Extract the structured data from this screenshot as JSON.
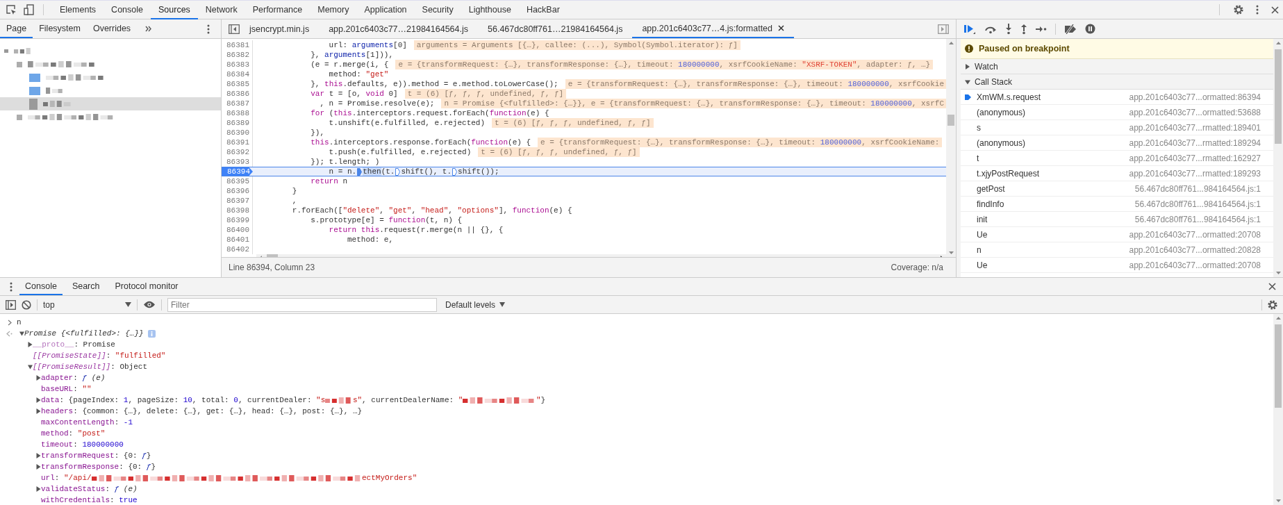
{
  "main_tabs": [
    {
      "label": "Elements",
      "selected": false
    },
    {
      "label": "Console",
      "selected": false
    },
    {
      "label": "Sources",
      "selected": true
    },
    {
      "label": "Network",
      "selected": false
    },
    {
      "label": "Performance",
      "selected": false
    },
    {
      "label": "Memory",
      "selected": false
    },
    {
      "label": "Application",
      "selected": false
    },
    {
      "label": "Security",
      "selected": false
    },
    {
      "label": "Lighthouse",
      "selected": false
    },
    {
      "label": "HackBar",
      "selected": false
    }
  ],
  "navigator": {
    "tabs": [
      {
        "label": "Page",
        "selected": true
      },
      {
        "label": "Filesystem",
        "selected": false
      },
      {
        "label": "Overrides",
        "selected": false
      }
    ],
    "tree": [
      {
        "kind": "frame",
        "selected": false,
        "children": [
          {
            "kind": "domain",
            "selected": false,
            "children": [
              {
                "kind": "folder",
                "selected": false
              },
              {
                "kind": "folder",
                "selected": false
              },
              {
                "kind": "file",
                "selected": true
              }
            ]
          },
          {
            "kind": "domain",
            "selected": false
          }
        ]
      }
    ]
  },
  "editor": {
    "tabs": [
      {
        "label": "jsencrypt.min.js",
        "selected": false,
        "closable": false
      },
      {
        "label": "app.201c6403c77…21984164564.js",
        "selected": false,
        "closable": false
      },
      {
        "label": "56.467dc80ff761…21984164564.js",
        "selected": false,
        "closable": false
      },
      {
        "label": "app.201c6403c77…4.js:formatted",
        "selected": true,
        "closable": true
      }
    ],
    "lines": [
      {
        "number": "86381",
        "current": false,
        "tokens": [
          {
            "kind": "plain",
            "text": "                url: "
          },
          {
            "kind": "var",
            "text": "arguments"
          },
          {
            "kind": "plain",
            "text": "[0]"
          }
        ],
        "inline": [
          {
            "kind": "plain",
            "text": "arguments = Arguments [{…}, callee: (...), Symbol(Symbol.iterator): ƒ]"
          }
        ]
      },
      {
        "number": "86382",
        "current": false,
        "tokens": [
          {
            "kind": "plain",
            "text": "            }, "
          },
          {
            "kind": "var",
            "text": "arguments"
          },
          {
            "kind": "plain",
            "text": "[1])),"
          }
        ]
      },
      {
        "number": "86383",
        "current": false,
        "tokens": [
          {
            "kind": "plain",
            "text": "            (e = r.merge(i, {"
          }
        ],
        "inline": [
          {
            "kind": "plain",
            "text": "e = {transformRequest: {…}, transformResponse: {…}, timeout: "
          },
          {
            "kind": "num",
            "text": "180000000"
          },
          {
            "kind": "plain",
            "text": ", xsrfCookieName: "
          },
          {
            "kind": "str",
            "text": "\"XSRF-TOKEN\""
          },
          {
            "kind": "plain",
            "text": ", adapter: ƒ, …}"
          }
        ]
      },
      {
        "number": "86384",
        "current": false,
        "tokens": [
          {
            "kind": "plain",
            "text": "                method: "
          },
          {
            "kind": "str",
            "text": "\"get\""
          }
        ]
      },
      {
        "number": "86385",
        "current": false,
        "tokens": [
          {
            "kind": "plain",
            "text": "            }, "
          },
          {
            "kind": "kw",
            "text": "this"
          },
          {
            "kind": "plain",
            "text": ".defaults, e)).method = e.method.toLowerCase();"
          }
        ],
        "inline": [
          {
            "kind": "plain",
            "text": "e = {transformRequest: {…}, transformResponse: {…}, timeout: "
          },
          {
            "kind": "num",
            "text": "180000000"
          },
          {
            "kind": "plain",
            "text": ", xsrfCookie"
          }
        ]
      },
      {
        "number": "86386",
        "current": false,
        "tokens": [
          {
            "kind": "kw",
            "text": "            var"
          },
          {
            "kind": "plain",
            "text": " t = [o, "
          },
          {
            "kind": "kw",
            "text": "void"
          },
          {
            "kind": "plain",
            "text": " 0]"
          }
        ],
        "inline": [
          {
            "kind": "plain",
            "text": "t = (6) [ƒ, ƒ, ƒ, undefined, ƒ, ƒ]"
          }
        ]
      },
      {
        "number": "86387",
        "current": false,
        "tokens": [
          {
            "kind": "plain",
            "text": "              , n = Promise.resolve(e);"
          }
        ],
        "inline": [
          {
            "kind": "plain",
            "text": "n = Promise {<fulfilled>: {…}}, e = {transformRequest: {…}, transformResponse: {…}, timeout: "
          },
          {
            "kind": "num",
            "text": "180000000"
          },
          {
            "kind": "plain",
            "text": ", xsrfC"
          }
        ]
      },
      {
        "number": "86388",
        "current": false,
        "tokens": [
          {
            "kind": "kw",
            "text": "            for"
          },
          {
            "kind": "plain",
            "text": " ("
          },
          {
            "kind": "kw",
            "text": "this"
          },
          {
            "kind": "plain",
            "text": ".interceptors.request.forEach("
          },
          {
            "kind": "kw",
            "text": "function"
          },
          {
            "kind": "plain",
            "text": "(e) {"
          }
        ]
      },
      {
        "number": "86389",
        "current": false,
        "tokens": [
          {
            "kind": "plain",
            "text": "                t.unshift(e.fulfilled, e.rejected)"
          }
        ],
        "inline": [
          {
            "kind": "plain",
            "text": "t = (6) [ƒ, ƒ, ƒ, undefined, ƒ, ƒ]"
          }
        ]
      },
      {
        "number": "86390",
        "current": false,
        "tokens": [
          {
            "kind": "plain",
            "text": "            }),"
          }
        ]
      },
      {
        "number": "86391",
        "current": false,
        "tokens": [
          {
            "kind": "kw",
            "text": "            this"
          },
          {
            "kind": "plain",
            "text": ".interceptors.response.forEach("
          },
          {
            "kind": "kw",
            "text": "function"
          },
          {
            "kind": "plain",
            "text": "(e) {"
          }
        ],
        "inline": [
          {
            "kind": "plain",
            "text": "e = {transformRequest: {…}, transformResponse: {…}, timeout: "
          },
          {
            "kind": "num",
            "text": "180000000"
          },
          {
            "kind": "plain",
            "text": ", xsrfCookieName:"
          }
        ]
      },
      {
        "number": "86392",
        "current": false,
        "tokens": [
          {
            "kind": "plain",
            "text": "                t.push(e.fulfilled, e.rejected)"
          }
        ],
        "inline": [
          {
            "kind": "plain",
            "text": "t = (6) [ƒ, ƒ, ƒ, undefined, ƒ, ƒ]"
          }
        ]
      },
      {
        "number": "86393",
        "current": false,
        "tokens": [
          {
            "kind": "plain",
            "text": "            }); t.length; )"
          }
        ]
      },
      {
        "number": "86394",
        "current": true,
        "tokens": [
          {
            "kind": "plain",
            "text": "                n = n."
          },
          {
            "kind": "marker",
            "active": true
          },
          {
            "kind": "exec",
            "text": "then"
          },
          {
            "kind": "plain",
            "text": "(t."
          },
          {
            "kind": "marker",
            "active": false
          },
          {
            "kind": "plain",
            "text": "shift(), t."
          },
          {
            "kind": "marker",
            "active": false
          },
          {
            "kind": "plain",
            "text": "shift());"
          }
        ]
      },
      {
        "number": "86395",
        "current": false,
        "tokens": [
          {
            "kind": "kw",
            "text": "            return"
          },
          {
            "kind": "plain",
            "text": " n"
          }
        ]
      },
      {
        "number": "86396",
        "current": false,
        "tokens": [
          {
            "kind": "plain",
            "text": "        }"
          }
        ]
      },
      {
        "number": "86397",
        "current": false,
        "tokens": [
          {
            "kind": "plain",
            "text": "        ,"
          }
        ]
      },
      {
        "number": "86398",
        "current": false,
        "tokens": [
          {
            "kind": "plain",
            "text": "        r.forEach(["
          },
          {
            "kind": "str",
            "text": "\"delete\""
          },
          {
            "kind": "plain",
            "text": ", "
          },
          {
            "kind": "str",
            "text": "\"get\""
          },
          {
            "kind": "plain",
            "text": ", "
          },
          {
            "kind": "str",
            "text": "\"head\""
          },
          {
            "kind": "plain",
            "text": ", "
          },
          {
            "kind": "str",
            "text": "\"options\""
          },
          {
            "kind": "plain",
            "text": "], "
          },
          {
            "kind": "kw",
            "text": "function"
          },
          {
            "kind": "plain",
            "text": "(e) {"
          }
        ]
      },
      {
        "number": "86399",
        "current": false,
        "tokens": [
          {
            "kind": "plain",
            "text": "            s.prototype[e] = "
          },
          {
            "kind": "kw",
            "text": "function"
          },
          {
            "kind": "plain",
            "text": "(t, n) {"
          }
        ]
      },
      {
        "number": "86400",
        "current": false,
        "tokens": [
          {
            "kind": "kw",
            "text": "                return this"
          },
          {
            "kind": "plain",
            "text": ".request(r.merge(n || {}, {"
          }
        ]
      },
      {
        "number": "86401",
        "current": false,
        "tokens": [
          {
            "kind": "plain",
            "text": "                    method: e,"
          }
        ]
      },
      {
        "number": "86402",
        "current": false
      }
    ],
    "status": {
      "position": "Line 86394, Column 23",
      "coverage": "Coverage: n/a"
    }
  },
  "debugger": {
    "banner": "Paused on breakpoint",
    "sections": [
      {
        "title": "Watch",
        "expanded": false
      },
      {
        "title": "Call Stack",
        "expanded": true
      }
    ],
    "call_stack": [
      {
        "name": "XmWM.s.request",
        "location": "app.201c6403c77...ormatted:86394",
        "current": true
      },
      {
        "name": "(anonymous)",
        "location": "app.201c6403c77...ormatted:53688",
        "current": false
      },
      {
        "name": "s",
        "location": "app.201c6403c77...rmatted:189401",
        "current": false
      },
      {
        "name": "(anonymous)",
        "location": "app.201c6403c77...rmatted:189294",
        "current": false
      },
      {
        "name": "t",
        "location": "app.201c6403c77...rmatted:162927",
        "current": false
      },
      {
        "name": "t.xjyPostRequest",
        "location": "app.201c6403c77...rmatted:189293",
        "current": false
      },
      {
        "name": "getPost",
        "location": "56.467dc80ff761...984164564.js:1",
        "current": false
      },
      {
        "name": "findInfo",
        "location": "56.467dc80ff761...984164564.js:1",
        "current": false
      },
      {
        "name": "init",
        "location": "56.467dc80ff761...984164564.js:1",
        "current": false
      },
      {
        "name": "Ue",
        "location": "app.201c6403c77...ormatted:20708",
        "current": false
      },
      {
        "name": "n",
        "location": "app.201c6403c77...ormatted:20828",
        "current": false
      },
      {
        "name": "Ue",
        "location": "app.201c6403c77...ormatted:20708",
        "current": false
      }
    ]
  },
  "drawer": {
    "tabs": [
      {
        "label": "Console",
        "selected": true
      },
      {
        "label": "Search",
        "selected": false
      },
      {
        "label": "Protocol monitor",
        "selected": false
      }
    ],
    "context": "top",
    "filter": {
      "placeholder": "Filter"
    },
    "levels": "Default levels",
    "input": "n",
    "result": {
      "kind": "object",
      "expanded": true,
      "tokens": [
        {
          "kind": "italic",
          "text": "Promise {<fulfilled>: {…}}"
        }
      ],
      "children": [
        {
          "kind": "object",
          "expanded": false,
          "tokens": [
            {
              "kind": "key_dim",
              "text": "__proto__"
            },
            {
              "kind": "plain",
              "text": ": Promise"
            }
          ]
        },
        {
          "kind": "value",
          "tokens": [
            {
              "kind": "key_internal",
              "text": "[[PromiseState]]"
            },
            {
              "kind": "plain",
              "text": ": "
            },
            {
              "kind": "str",
              "text": "\"fulfilled\""
            }
          ]
        },
        {
          "kind": "object",
          "expanded": true,
          "tokens": [
            {
              "kind": "key_internal",
              "text": "[[PromiseResult]]"
            },
            {
              "kind": "plain",
              "text": ": Object"
            }
          ],
          "children": [
            {
              "kind": "object",
              "expanded": false,
              "tokens": [
                {
                  "kind": "key",
                  "text": "adapter"
                },
                {
                  "kind": "plain",
                  "text": ": "
                },
                {
                  "kind": "fn",
                  "text": "ƒ"
                },
                {
                  "kind": "italic",
                  "text": " (e)"
                }
              ]
            },
            {
              "kind": "value",
              "tokens": [
                {
                  "kind": "key",
                  "text": "baseURL"
                },
                {
                  "kind": "plain",
                  "text": ": "
                },
                {
                  "kind": "str",
                  "text": "\"\""
                }
              ]
            },
            {
              "kind": "object",
              "expanded": false,
              "tokens": [
                {
                  "kind": "key",
                  "text": "data"
                },
                {
                  "kind": "plain",
                  "text": ": {pageIndex: "
                },
                {
                  "kind": "num",
                  "text": "1"
                },
                {
                  "kind": "plain",
                  "text": ", pageSize: "
                },
                {
                  "kind": "num",
                  "text": "10"
                },
                {
                  "kind": "plain",
                  "text": ", total: "
                },
                {
                  "kind": "num",
                  "text": "0"
                },
                {
                  "kind": "plain",
                  "text": ", currentDealer: "
                },
                {
                  "kind": "str",
                  "text": "\"s"
                },
                {
                  "kind": "redacted"
                },
                {
                  "kind": "str",
                  "text": "s\""
                },
                {
                  "kind": "plain",
                  "text": ", currentDealerName: "
                },
                {
                  "kind": "str",
                  "text": "\""
                },
                {
                  "kind": "redacted"
                },
                {
                  "kind": "str",
                  "text": "\""
                },
                {
                  "kind": "plain",
                  "text": "}"
                }
              ]
            },
            {
              "kind": "object",
              "expanded": false,
              "tokens": [
                {
                  "kind": "key",
                  "text": "headers"
                },
                {
                  "kind": "plain",
                  "text": ": {common: {…}, delete: {…}, get: {…}, head: {…}, post: {…}, …}"
                }
              ]
            },
            {
              "kind": "value",
              "tokens": [
                {
                  "kind": "key",
                  "text": "maxContentLength"
                },
                {
                  "kind": "plain",
                  "text": ": "
                },
                {
                  "kind": "num",
                  "text": "-1"
                }
              ]
            },
            {
              "kind": "value",
              "tokens": [
                {
                  "kind": "key",
                  "text": "method"
                },
                {
                  "kind": "plain",
                  "text": ": "
                },
                {
                  "kind": "str",
                  "text": "\"post\""
                }
              ]
            },
            {
              "kind": "value",
              "tokens": [
                {
                  "kind": "key",
                  "text": "timeout"
                },
                {
                  "kind": "plain",
                  "text": ": "
                },
                {
                  "kind": "num",
                  "text": "180000000"
                }
              ]
            },
            {
              "kind": "object",
              "expanded": false,
              "tokens": [
                {
                  "kind": "key",
                  "text": "transformRequest"
                },
                {
                  "kind": "plain",
                  "text": ": {0: "
                },
                {
                  "kind": "fn",
                  "text": "ƒ"
                },
                {
                  "kind": "plain",
                  "text": "}"
                }
              ]
            },
            {
              "kind": "object",
              "expanded": false,
              "tokens": [
                {
                  "kind": "key",
                  "text": "transformResponse"
                },
                {
                  "kind": "plain",
                  "text": ": {0: "
                },
                {
                  "kind": "fn",
                  "text": "ƒ"
                },
                {
                  "kind": "plain",
                  "text": "}"
                }
              ]
            },
            {
              "kind": "value",
              "tokens": [
                {
                  "kind": "key",
                  "text": "url"
                },
                {
                  "kind": "plain",
                  "text": ": "
                },
                {
                  "kind": "str",
                  "text": "\"/api/"
                },
                {
                  "kind": "redacted"
                },
                {
                  "kind": "str",
                  "text": "ectMyOrders\""
                }
              ]
            },
            {
              "kind": "object",
              "expanded": false,
              "tokens": [
                {
                  "kind": "key",
                  "text": "validateStatus"
                },
                {
                  "kind": "plain",
                  "text": ": "
                },
                {
                  "kind": "fn",
                  "text": "ƒ"
                },
                {
                  "kind": "italic",
                  "text": " (e)"
                }
              ]
            },
            {
              "kind": "value",
              "tokens": [
                {
                  "kind": "key",
                  "text": "withCredentials"
                },
                {
                  "kind": "plain",
                  "text": ": "
                },
                {
                  "kind": "bool",
                  "text": "true"
                }
              ]
            }
          ]
        }
      ]
    }
  }
}
